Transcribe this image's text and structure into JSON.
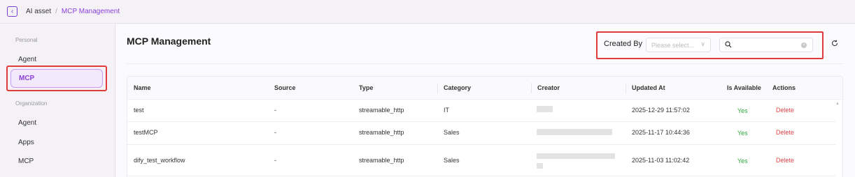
{
  "breadcrumb": {
    "root": "AI asset",
    "separator": "/",
    "current": "MCP Management"
  },
  "sidebar": {
    "personal_label": "Personal",
    "personal_items": [
      "Agent",
      "MCP"
    ],
    "organization_label": "Organization",
    "organization_items": [
      "Agent",
      "Apps",
      "MCP"
    ]
  },
  "page": {
    "title": "MCP Management"
  },
  "filter": {
    "created_by_label": "Created By",
    "select_placeholder": "Please select...",
    "search_value": ""
  },
  "table": {
    "columns": [
      "Name",
      "Source",
      "Type",
      "Category",
      "Creator",
      "Updated At",
      "Is Available",
      "Actions"
    ],
    "rows": [
      {
        "name": "test",
        "source": "-",
        "type": "streamable_http",
        "category": "IT",
        "updated_at": "2025-12-29 11:57:02",
        "available": "Yes",
        "action": "Delete"
      },
      {
        "name": "testMCP",
        "source": "-",
        "type": "streamable_http",
        "category": "Sales",
        "updated_at": "2025-11-17 10:44:36",
        "available": "Yes",
        "action": "Delete"
      },
      {
        "name": "dify_test_workflow",
        "source": "-",
        "type": "streamable_http",
        "category": "Sales",
        "updated_at": "2025-11-03 11:02:42",
        "available": "Yes",
        "action": "Delete"
      }
    ]
  },
  "colors": {
    "accent": "#8a3fd8",
    "highlight": "#e03a3a",
    "yes": "#2eaa3a",
    "delete": "#e04848"
  }
}
